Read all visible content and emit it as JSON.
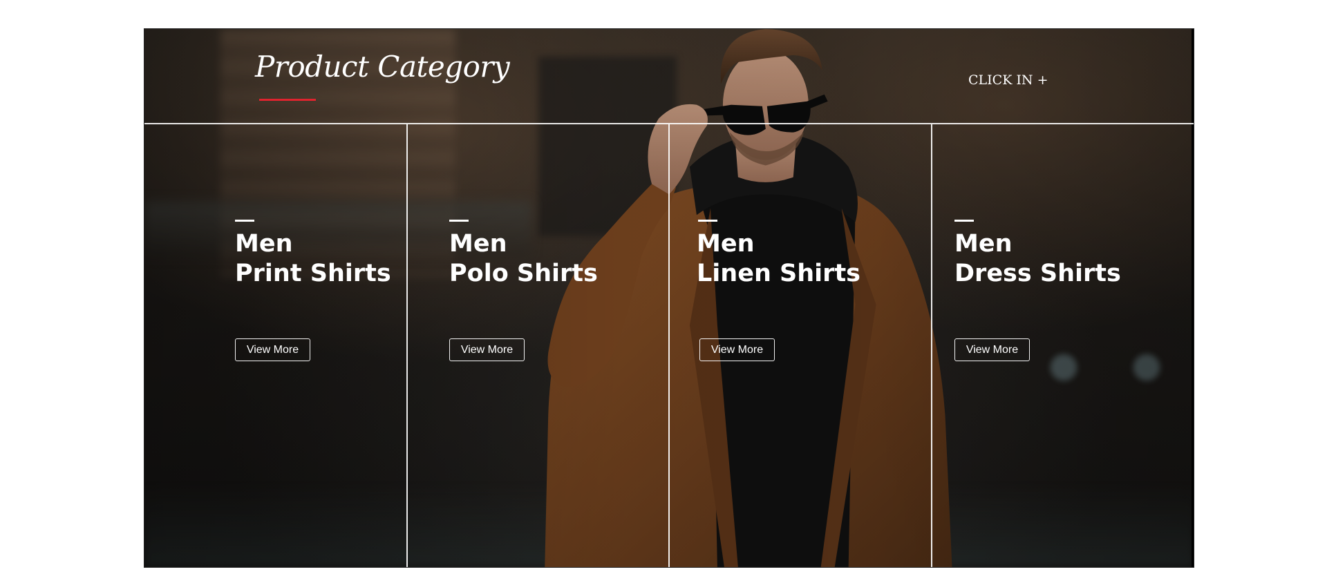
{
  "header": {
    "title": "Product Category",
    "click_in_label": "CLICK IN +"
  },
  "categories": [
    {
      "line1": "Men",
      "line2": "Print Shirts",
      "button_label": "View More"
    },
    {
      "line1": "Men",
      "line2": "Polo Shirts",
      "button_label": "View More"
    },
    {
      "line1": "Men",
      "line2": "Linen Shirts",
      "button_label": "View More"
    },
    {
      "line1": "Men",
      "line2": "Dress Shirts",
      "button_label": "View More"
    }
  ],
  "colors": {
    "accent": "#e0232e",
    "text": "#ffffff",
    "divider": "#ffffff"
  }
}
